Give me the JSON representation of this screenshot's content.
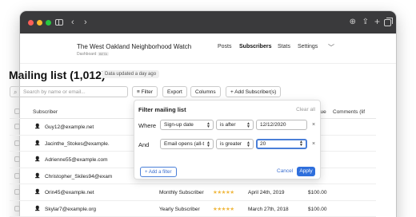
{
  "browser": {
    "buttons": {
      "back": "‹",
      "forward": "›",
      "download": "⊕",
      "share": "⇪",
      "new_tab": "+"
    }
  },
  "site": {
    "title": "The West Oakland Neighborhood Watch",
    "subtitle": "Dashboard",
    "beta": "BETA",
    "nav": [
      "Posts",
      "Subscribers",
      "Stats",
      "Settings"
    ],
    "nav_active": "Subscribers"
  },
  "page": {
    "title": "Mailing list (1,012)",
    "updated": "Data updated a day ago"
  },
  "toolbar": {
    "search_placeholder": "Search by name or email...",
    "filter": "Filter",
    "export": "Export",
    "columns": "Columns",
    "add_subscribers": "+ Add Subscriber(s)"
  },
  "table": {
    "headers": {
      "subscriber": "Subscriber",
      "revenue": "venue",
      "comments": "Comments (lif"
    },
    "rows": [
      {
        "email": "Guy12@example.net",
        "type": "",
        "stars": "",
        "date": "",
        "revenue": ""
      },
      {
        "email": "Jacinthe_Stokes@example.",
        "type": "",
        "stars": "",
        "date": "",
        "revenue": ""
      },
      {
        "email": "Adrienne55@example.com",
        "type": "",
        "stars": "",
        "date": "",
        "revenue": ""
      },
      {
        "email": "Christopher_Skiles94@exam",
        "type": "",
        "stars": "",
        "date": "",
        "revenue": ""
      },
      {
        "email": "Orin45@example.net",
        "type": "Monthly Subscriber",
        "stars": "★★★★★",
        "date": "April 24th, 2019",
        "revenue": "$100.00"
      },
      {
        "email": "Skylar7@example.org",
        "type": "Yearly Subscriber",
        "stars": "★★★★★",
        "date": "March 27th, 2018",
        "revenue": "$100.00"
      }
    ]
  },
  "filter_popup": {
    "title": "Filter mailing list",
    "clear_all": "Clear all",
    "conditions": [
      {
        "conjunction": "Where",
        "field": "Sign-up date",
        "operator": "is after",
        "value": "12/12/2020"
      },
      {
        "conjunction": "And",
        "field": "Email opens (all-t",
        "operator": "is greater",
        "value": "20"
      }
    ],
    "remove": "×",
    "add_filter": "+ Add a filter",
    "cancel": "Cancel",
    "apply": "Apply"
  },
  "colors": {
    "accent": "#2f6fdc",
    "stars": "#f0b840",
    "titlebar": "#3a3a3c"
  }
}
